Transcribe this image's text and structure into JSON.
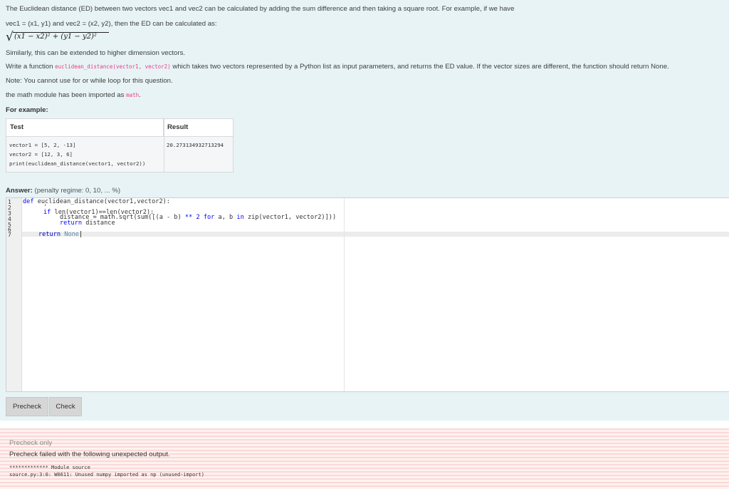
{
  "question": {
    "line1": "The Euclidean distance (ED) between two vectors vec1 and vec2 can be calculated by adding the sum difference and then taking a square root. For example, if we have",
    "line2": "vec1 = (x1, y1) and vec2 = (x2, y2), then the ED can be calculated as:",
    "formula": "(x1 − x2)² + (y1 − y2)²",
    "line3": "Similarly, this can be extended to higher dimension vectors.",
    "line4_prefix": "Write a function ",
    "line4_code": "euclidean_distance(vector1, vector2)",
    "line4_suffix": " which takes two vectors represented by a Python list as input parameters, and returns the ED value. If the vector sizes are different, the function should return None.",
    "line5": "Note: You cannot use for or while loop for this question.",
    "line6_prefix": "the math module has been imported as ",
    "line6_code": "math",
    "line6_suffix": ".",
    "for_example": "For example:"
  },
  "example_table": {
    "headers": [
      "Test",
      "Result"
    ],
    "test_lines": [
      "vector1 = [5, 2, -13]",
      "vector2 = [12, 3, 6]",
      "print(euclidean_distance(vector1, vector2))"
    ],
    "result": "20.273134932713294"
  },
  "answer": {
    "label": "Answer:",
    "penalty": "(penalty regime: 0, 10, ... %)"
  },
  "editor": {
    "line_numbers": [
      "1",
      "2",
      "3",
      "4",
      "5",
      "6",
      "7"
    ],
    "code": {
      "l1_kw": "def",
      "l1_rest": " euclidean_distance(vector1,vector2):",
      "l2": "'",
      "l3_kw": "if",
      "l3_rest": " len(vector1)==len(vector2):",
      "l4_a": "distance = math.sqrt(sum([(a - b) ",
      "l4_op": "**",
      "l4_num": " 2",
      "l4_b": " ",
      "l4_for": "for",
      "l4_c": " a, b ",
      "l4_in": "in",
      "l4_d": " zip(vector1, vector2)]))",
      "l5_kw": "return",
      "l5_rest": " distance",
      "l7_kw": "return",
      "l7_lit": " None"
    }
  },
  "buttons": {
    "precheck": "Precheck",
    "check": "Check"
  },
  "feedback": {
    "precheck_only": "Precheck only",
    "message": "Precheck failed with the following unexpected output.",
    "output_line1": "************* Module source",
    "output_line2": "source.py:3:0: W0611: Unused numpy imported as np (unused-import)"
  },
  "colors": {
    "question_bg": "#e7f3f5",
    "inline_code": "#e83e8c",
    "keyword": "#0000ff",
    "feedback_stripe": "#fbd7dc"
  }
}
